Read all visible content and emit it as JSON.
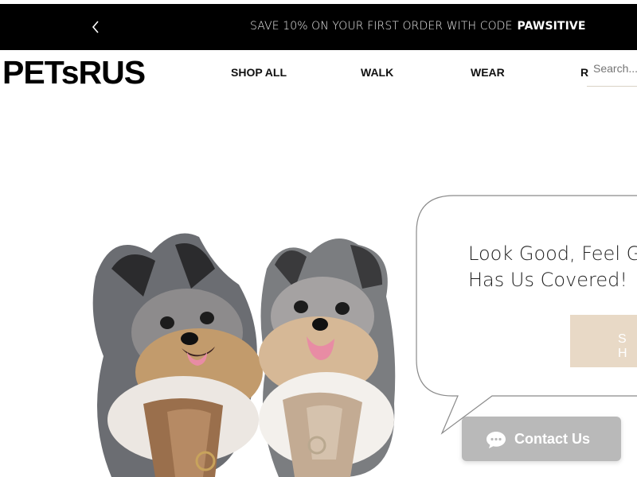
{
  "announcement": {
    "text": "SAVE 10% ON YOUR FIRST ORDER WITH CODE",
    "code": "PAWSITIVE",
    "prev_icon": "chevron-left-icon"
  },
  "brand": {
    "logo_part1": "PETs",
    "logo_part2": "RUS"
  },
  "nav": {
    "items": [
      {
        "label": "SHOP ALL"
      },
      {
        "label": "WALK"
      },
      {
        "label": "WEAR"
      },
      {
        "label": "R"
      }
    ]
  },
  "search": {
    "placeholder": "Search..."
  },
  "hero": {
    "tagline_line1": "Look Good, Feel Gr",
    "tagline_line2": "Has Us Covered!",
    "shop_button_label": "S H",
    "image_alt": "two pomeranian dogs wearing harnesses"
  },
  "contact": {
    "label": "Contact Us",
    "icon": "chat-bubble-icon"
  },
  "colors": {
    "announcement_bg": "#000000",
    "button_beige": "#e8d9c6",
    "contact_gray": "#b9b9b9",
    "bubble_outline": "#8a8a8a"
  }
}
